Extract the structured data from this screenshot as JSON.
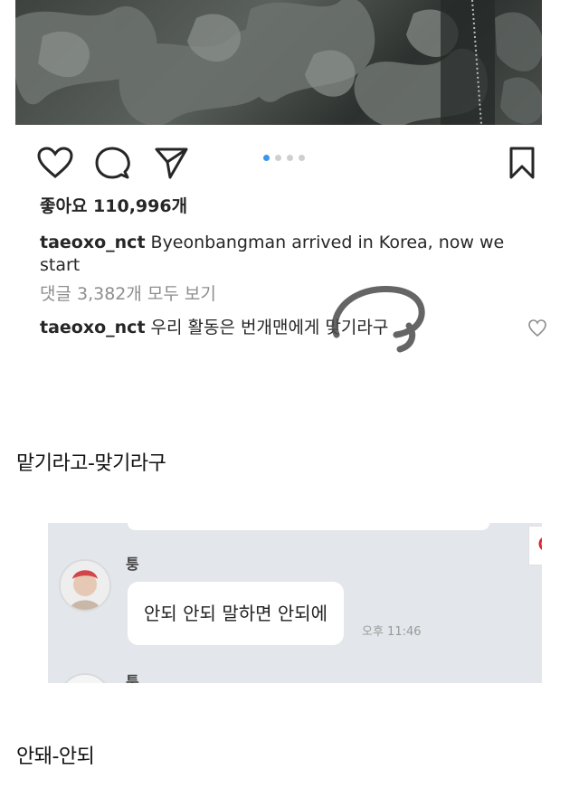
{
  "post": {
    "likes": "좋아요 110,996개",
    "caption_user": "taeoxo_nct",
    "caption_text": "Byeonbangman arrived in Korea, now we start",
    "view_comments": "댓글 3,382개 모두 보기",
    "comment_user": "taeoxo_nct",
    "comment_text": "우리 활동은 번개맨에게 맞기라구",
    "icons": {
      "like": "heart-icon",
      "comment": "comment-icon",
      "share": "send-icon",
      "save": "bookmark-icon",
      "comment_like": "heart-icon"
    },
    "carousel": {
      "count": 4,
      "active_index": 0
    },
    "colors": {
      "accent": "#3897f0",
      "meta_gray": "#8e8e8e",
      "text": "#262626"
    }
  },
  "captions": {
    "first": "맡기라고-맞기라구",
    "second": "안돼-안되"
  },
  "chat": {
    "sender_1": "퉁",
    "message_1": "안되 안되 말하면 안되에",
    "time_1": "오후 11:46",
    "sender_2": "퉁",
    "search_icon": "search-icon",
    "search_color": "#e0262b"
  }
}
